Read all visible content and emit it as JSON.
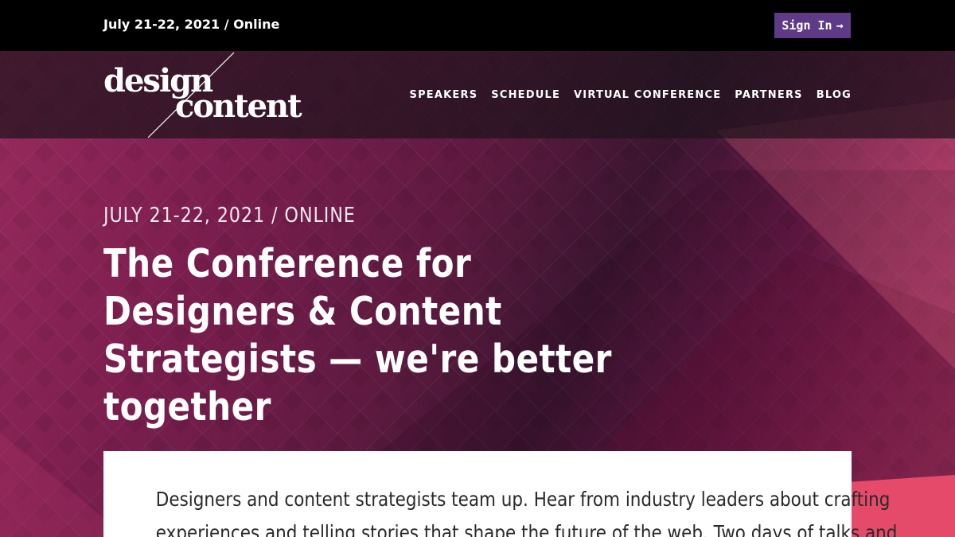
{
  "topbar": {
    "date": "July 21-22, 2021 / Online",
    "signin_label": "Sign In",
    "signin_icon": "arrow-right-icon"
  },
  "logo": {
    "line1": "design",
    "line2": "content"
  },
  "nav": {
    "items": [
      "SPEAKERS",
      "SCHEDULE",
      "VIRTUAL CONFERENCE",
      "PARTNERS",
      "BLOG"
    ]
  },
  "hero": {
    "kicker": "JULY 21-22, 2021 / ONLINE",
    "headline": "The Conference for Designers & Content Strategists — we're better together"
  },
  "intro": {
    "line1": "Designers and content strategists team up. Hear from industry leaders about crafting",
    "line2": "experiences and telling stories that shape the future of the web. Two days of talks and"
  },
  "colors": {
    "accent": "#5e3a87",
    "hero_pink": "#a02e62",
    "hero_dark": "#3a1530",
    "corner_red": "#e54a6a"
  }
}
